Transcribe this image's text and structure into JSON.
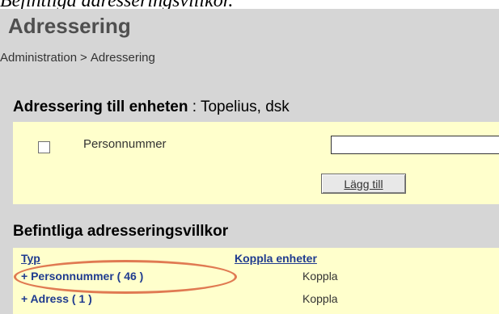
{
  "caption": "Befintliga adresseringsvillkor.",
  "page": {
    "title": "Adressering",
    "breadcrumb": {
      "root": "Administration",
      "separator": ">",
      "current": "Adressering"
    }
  },
  "unit_section": {
    "heading_bold": "Adressering till enheten",
    "heading_rest": " : Topelius, dsk",
    "checkbox_checked": false,
    "field_label": "Personnummer",
    "input_value": "",
    "add_button_label": "Lägg till"
  },
  "existing_section": {
    "heading": "Befintliga adresseringsvillkor",
    "columns": {
      "type": "Typ",
      "link_units": "Koppla enheter"
    },
    "rows": [
      {
        "label": "+ Personnummer ( 46 )",
        "action": "Koppla",
        "highlighted": true
      },
      {
        "label": "+ Adress ( 1 )",
        "action": "Koppla",
        "highlighted": false
      }
    ]
  },
  "colors": {
    "panel_bg": "#d6d6d6",
    "box_bg": "#ffffcc",
    "link": "#1f3b8f",
    "highlight": "#e07a52"
  }
}
